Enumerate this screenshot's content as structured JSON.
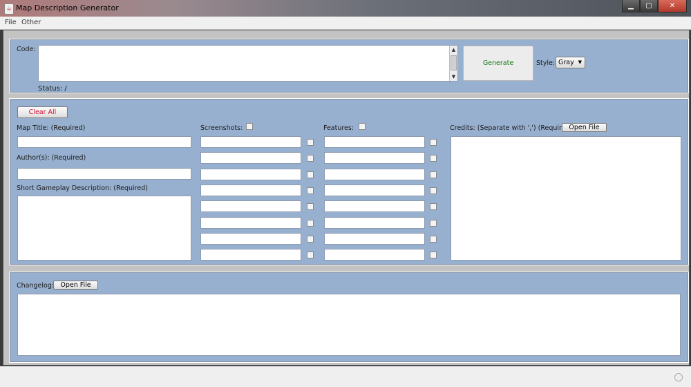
{
  "window": {
    "title": "Map Description Generator",
    "controls": {
      "minimize": "▁",
      "maximize": "▢",
      "close": "✕"
    }
  },
  "menu": {
    "file": "File",
    "other": "Other"
  },
  "code_panel": {
    "code_label": "Code:",
    "code_value": "",
    "status_label": "Status: /",
    "generate_button": "Generate",
    "style_label": "Style:",
    "style_selected": "Gray"
  },
  "form": {
    "clear_all_button": "Clear All",
    "map_title_label": "Map Title: (Required)",
    "map_title_value": "",
    "authors_label": "Author(s): (Required)",
    "authors_value": "",
    "description_label": "Short Gameplay Description: (Required)",
    "description_value": "",
    "screenshots_label": "Screenshots:",
    "screenshots": [
      "",
      "",
      "",
      "",
      "",
      "",
      "",
      ""
    ],
    "features_label": "Features:",
    "features": [
      "",
      "",
      "",
      "",
      "",
      "",
      "",
      ""
    ],
    "credits_label": "Credits: (Separate with ',') (Required)",
    "credits_open_file_button": "Open File",
    "credits_value": ""
  },
  "changelog": {
    "label": "Changelog:",
    "open_file_button": "Open File",
    "value": ""
  },
  "colors": {
    "panel_bg": "#98b0cf",
    "generate_text": "#1a7a1a",
    "clear_all_text": "#d01030"
  }
}
